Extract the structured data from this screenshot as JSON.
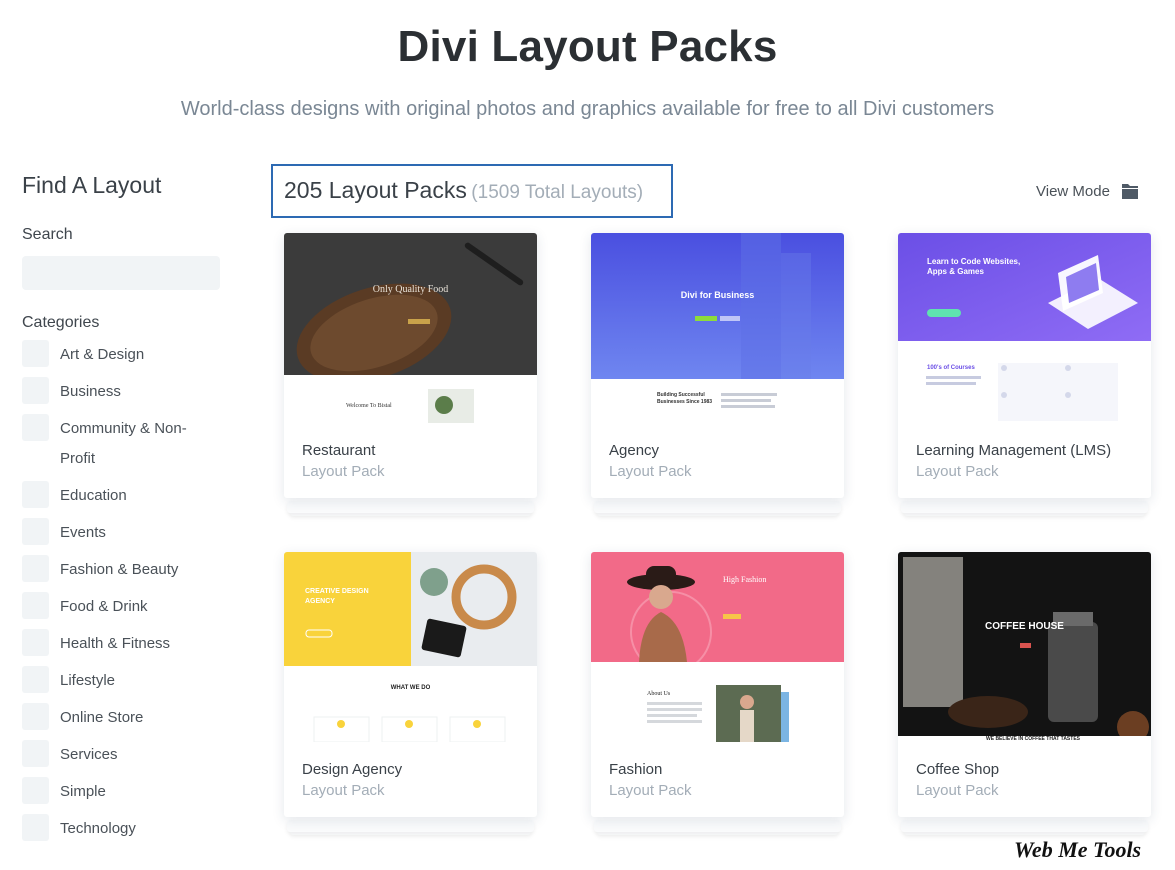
{
  "header": {
    "title": "Divi Layout Packs",
    "subtitle": "World-class designs with original photos and graphics available for free to all Divi customers"
  },
  "sidebar": {
    "title": "Find A Layout",
    "search_label": "Search",
    "search_value": "",
    "categories_label": "Categories",
    "categories": [
      "Art & Design",
      "Business",
      "Community & Non-Profit",
      "Education",
      "Events",
      "Fashion & Beauty",
      "Food & Drink",
      "Health & Fitness",
      "Lifestyle",
      "Online Store",
      "Services",
      "Simple",
      "Technology"
    ]
  },
  "results": {
    "count_text": "205 Layout Packs",
    "total_text": "(1509 Total Layouts)",
    "view_mode_label": "View Mode"
  },
  "cards": [
    {
      "name": "Restaurant",
      "subtitle": "Layout Pack",
      "preview_title": "Only Quality Food",
      "preview_section": "Welcome To Bistal"
    },
    {
      "name": "Agency",
      "subtitle": "Layout Pack",
      "preview_title": "Divi for Business",
      "preview_section": "Building Successful Businesses Since 1983"
    },
    {
      "name": "Learning Management (LMS)",
      "subtitle": "Layout Pack",
      "preview_title": "Learn to Code Websites, Apps & Games",
      "preview_section": "100's of Courses"
    },
    {
      "name": "Design Agency",
      "subtitle": "Layout Pack",
      "preview_title": "CREATIVE DESIGN AGENCY",
      "preview_section": "WHAT WE DO"
    },
    {
      "name": "Fashion",
      "subtitle": "Layout Pack",
      "preview_title": "High Fashion",
      "preview_section": "About Us"
    },
    {
      "name": "Coffee Shop",
      "subtitle": "Layout Pack",
      "preview_title": "COFFEE HOUSE",
      "preview_section": "WE BELIEVE IN COFFEE THAT TASTES"
    }
  ],
  "watermark": "Web Me Tools",
  "colors": {
    "accent_border": "#2d6ab3",
    "muted_text": "#a3adb7",
    "agency_blue": "#4a55e0",
    "lms_purple": "#7b5cf0",
    "design_yellow": "#f9d33b",
    "fashion_pink": "#f26a88"
  }
}
